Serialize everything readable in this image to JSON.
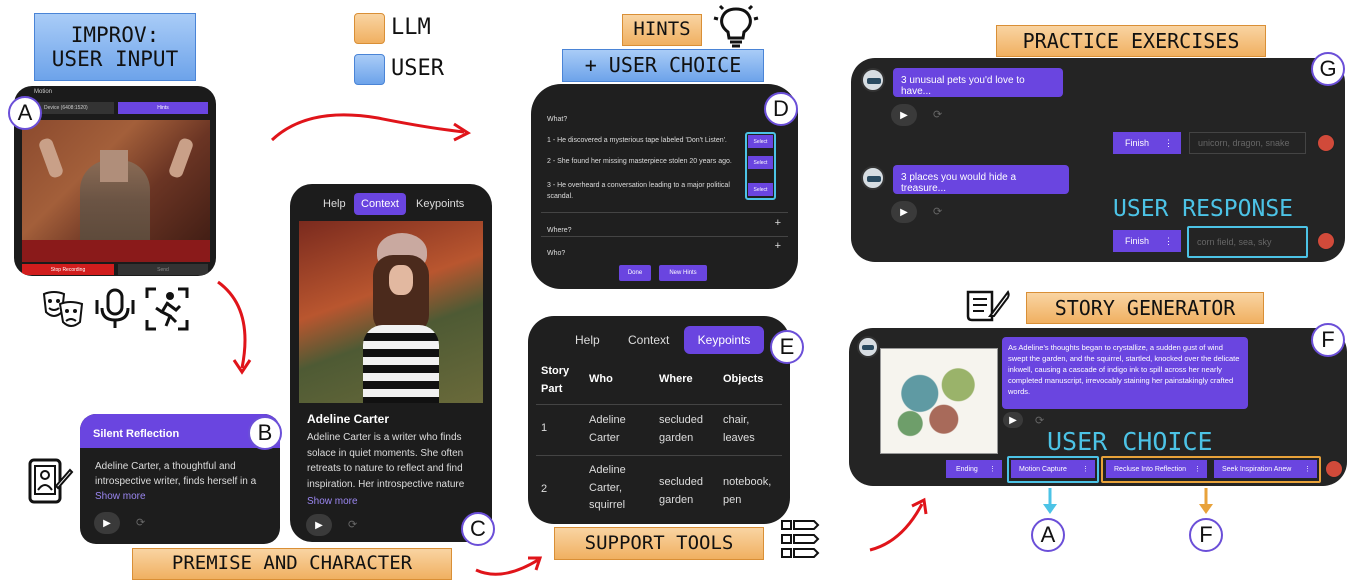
{
  "labels": {
    "improv": "IMPROV:\nUSER INPUT",
    "llm": "LLM",
    "user": "USER",
    "hints": "HINTS",
    "user_choice_top": "+ USER CHOICE",
    "practice": "PRACTICE EXERCISES",
    "story_generator": "STORY GENERATOR",
    "premise": "PREMISE AND CHARACTER",
    "support": "SUPPORT TOOLS",
    "user_response": "USER RESPONSE",
    "user_choice": "USER CHOICE"
  },
  "badges": {
    "a": "A",
    "b": "B",
    "c": "C",
    "d": "D",
    "e": "E",
    "f": "F",
    "g": "G",
    "a2": "A",
    "f2": "F"
  },
  "colors": {
    "purple": "#6a45e0",
    "cyan": "#4cc3e6",
    "orange": "#e8a23a",
    "red_arrow": "#e0141a"
  },
  "improv_panel": {
    "top_label": "Motion",
    "device": "Device (6408:1520)",
    "hints_button": "Hints",
    "stop_button": "Stop Recording",
    "send_button": "Send"
  },
  "premise_card": {
    "title": "Silent Reflection",
    "body": "Adeline Carter, a thoughtful and introspective writer, finds herself in a",
    "show_more": "Show more"
  },
  "character_card": {
    "tabs": [
      "Help",
      "Context",
      "Keypoints"
    ],
    "name": "Adeline Carter",
    "body": "Adeline Carter is a writer who finds solace in quiet moments. She often retreats to nature to reflect and find inspiration. Her introspective nature",
    "show_more": "Show more"
  },
  "hints_panel": {
    "question": "What?",
    "options": [
      "1 - He discovered a mysterious tape labeled 'Don't Listen'.",
      "2 - She found her missing masterpiece stolen 20 years ago.",
      "3 - He overheard a conversation leading to a major political scandal."
    ],
    "select_label": "Select",
    "where": "Where?",
    "who": "Who?",
    "plus": "+",
    "done": "Done",
    "new_hints": "New Hints"
  },
  "keypoints_panel": {
    "tabs": [
      "Help",
      "Context",
      "Keypoints"
    ],
    "headers": [
      "Story Part",
      "Who",
      "Where",
      "Objects"
    ],
    "rows": [
      [
        "1",
        "Adeline Carter",
        "secluded garden",
        "chair, leaves"
      ],
      [
        "2",
        "Adeline Carter, squirrel",
        "secluded garden",
        "notebook, pen"
      ]
    ]
  },
  "practice_panel": {
    "prompt1": "3 unusual pets you'd love to have...",
    "prompt2": "3 places you would hide a treasure...",
    "finish": "Finish",
    "dots": "⋮",
    "input1": "unicorn, dragon, snake",
    "input2": "corn field, sea, sky"
  },
  "story_panel": {
    "text": "As Adeline's thoughts began to crystallize, a sudden gust of wind swept the garden, and the squirrel, startled, knocked over the delicate inkwell, causing a cascade of indigo ink to spill across her nearly completed manuscript, irrevocably staining her painstakingly crafted words.",
    "choices": [
      "Ending",
      "Motion Capture",
      "Recluse Into Reflection",
      "Seek Inspiration Anew"
    ]
  }
}
